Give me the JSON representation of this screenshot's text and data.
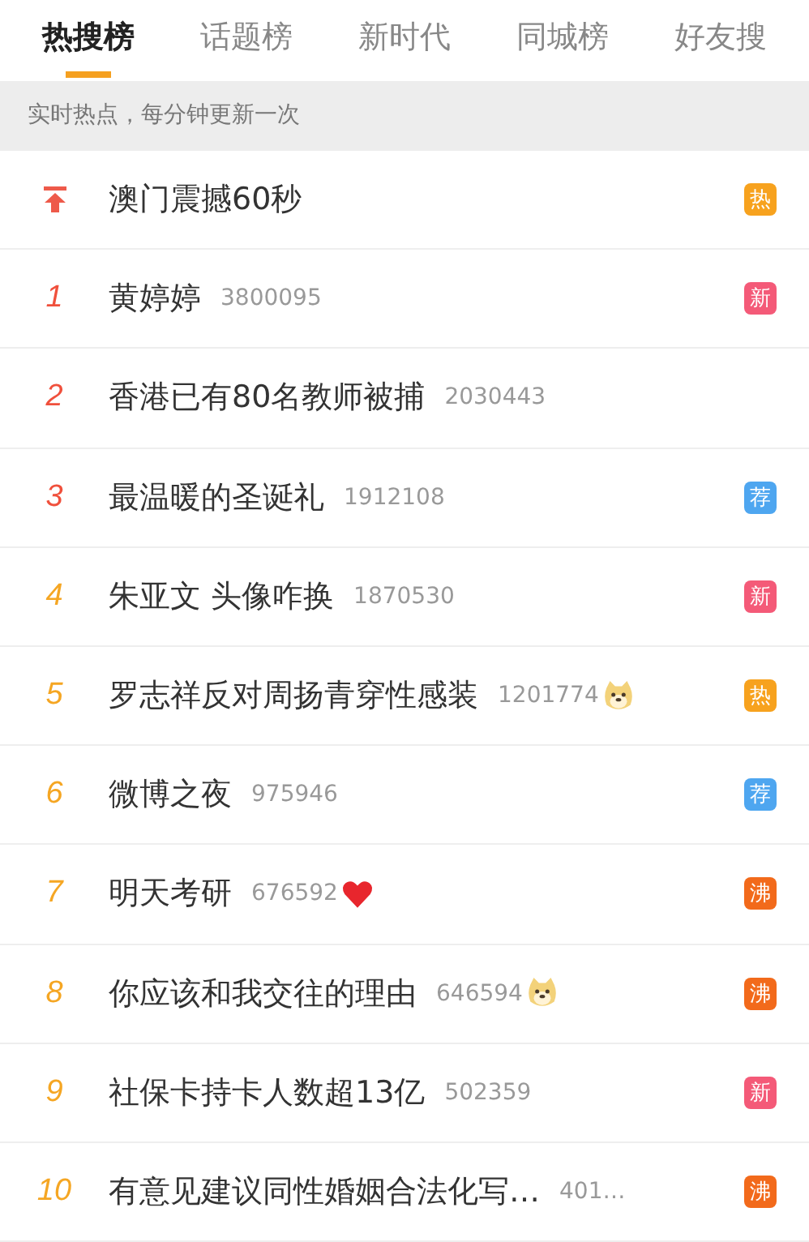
{
  "tabs": [
    {
      "label": "热搜榜",
      "selected": true
    },
    {
      "label": "话题榜",
      "selected": false
    },
    {
      "label": "新时代",
      "selected": false
    },
    {
      "label": "同城榜",
      "selected": false
    },
    {
      "label": "好友搜",
      "selected": false
    }
  ],
  "notice": "实时热点，每分钟更新一次",
  "items": [
    {
      "kind": "pinned",
      "title": "澳门震撼60秒",
      "badge": {
        "text": "热",
        "color": "#f7a21e"
      }
    },
    {
      "kind": "ranked",
      "rank": "1",
      "color": "#f0503c",
      "title": "黄婷婷",
      "count": "3800095",
      "badge": {
        "text": "新",
        "color": "#f45a78"
      }
    },
    {
      "kind": "ranked",
      "rank": "2",
      "color": "#f0503c",
      "title": "香港已有80名教师被捕",
      "count": "2030443"
    },
    {
      "kind": "ranked",
      "rank": "3",
      "color": "#f0503c",
      "title": "最温暖的圣诞礼",
      "count": "1912108",
      "badge": {
        "text": "荐",
        "color": "#4ea6f0"
      }
    },
    {
      "kind": "ranked",
      "rank": "4",
      "color": "#f5a623",
      "title": "朱亚文 头像咋换",
      "count": "1870530",
      "badge": {
        "text": "新",
        "color": "#f45a78"
      }
    },
    {
      "kind": "ranked",
      "rank": "5",
      "color": "#f5a623",
      "title": "罗志祥反对周扬青穿性感装",
      "count": "1201774",
      "emoji": {
        "kind": "dog"
      },
      "badge": {
        "text": "热",
        "color": "#f7a21e"
      }
    },
    {
      "kind": "ranked",
      "rank": "6",
      "color": "#f5a623",
      "title": "微博之夜",
      "count": "975946",
      "badge": {
        "text": "荐",
        "color": "#4ea6f0"
      }
    },
    {
      "kind": "ranked",
      "rank": "7",
      "color": "#f5a623",
      "title": "明天考研",
      "count": "676592",
      "emoji": {
        "kind": "heart"
      },
      "badge": {
        "text": "沸",
        "color": "#f26a1b"
      }
    },
    {
      "kind": "ranked",
      "rank": "8",
      "color": "#f5a623",
      "title": "你应该和我交往的理由",
      "count": "646594",
      "emoji": {
        "kind": "dog"
      },
      "badge": {
        "text": "沸",
        "color": "#f26a1b"
      }
    },
    {
      "kind": "ranked",
      "rank": "9",
      "color": "#f5a623",
      "title": "社保卡持卡人数超13亿",
      "count": "502359",
      "badge": {
        "text": "新",
        "color": "#f45a78"
      }
    },
    {
      "kind": "ranked",
      "rank": "10",
      "color": "#f5a623",
      "title": "有意见建议同性婚姻合法化写…",
      "count": "401…",
      "badge": {
        "text": "沸",
        "color": "#f26a1b"
      }
    }
  ]
}
